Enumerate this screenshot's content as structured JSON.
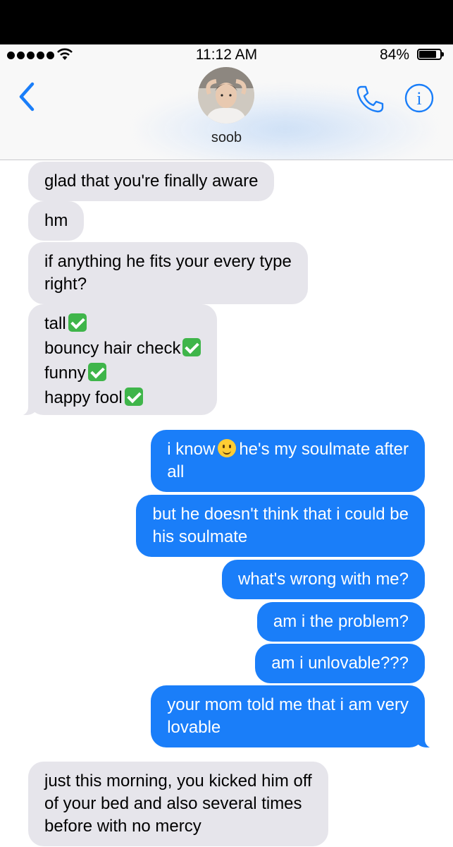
{
  "status_bar": {
    "time": "11:12 AM",
    "battery": "84%",
    "battery_level": 0.84
  },
  "header": {
    "contact_name": "soob",
    "icons": [
      "back-chevron-icon",
      "phone-icon",
      "info-icon",
      "contact-avatar"
    ],
    "accent_color": "#1a7ef9"
  },
  "messages": [
    {
      "side": "received",
      "text": "glad that you're finally aware"
    },
    {
      "side": "received",
      "text": "hm"
    },
    {
      "side": "received",
      "lines": [
        "if anything he fits your every type",
        "right?"
      ]
    },
    {
      "side": "received",
      "lines": [
        "tall",
        "bouncy hair check",
        "funny",
        "happy fool"
      ],
      "emoji": "✅"
    },
    {
      "side": "sent",
      "lines": [
        "i know",
        "he's my soulmate after",
        "all"
      ],
      "emoji": "🥲"
    },
    {
      "side": "sent",
      "lines": [
        "but he doesn't think that i could be",
        "his soulmate"
      ]
    },
    {
      "side": "sent",
      "text": "what's wrong with me?"
    },
    {
      "side": "sent",
      "text": "am i the problem?"
    },
    {
      "side": "sent",
      "text": "am i unlovable???"
    },
    {
      "side": "sent",
      "lines": [
        "your mom told me that i am very",
        "lovable"
      ]
    },
    {
      "side": "received",
      "lines": [
        "just this morning, you kicked him off",
        "of your bed and also several times",
        "before with no mercy"
      ]
    }
  ],
  "colors": {
    "received_bubble": "#e6e5eb",
    "sent_bubble": "#1a7ef9",
    "checkmark": "#3fb54a"
  }
}
